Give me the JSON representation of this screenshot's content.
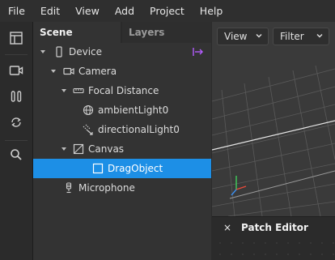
{
  "menu": [
    "File",
    "Edit",
    "View",
    "Add",
    "Project",
    "Help"
  ],
  "toolbar": {
    "icons": [
      "layout-icon",
      "camera-icon",
      "pause-icon",
      "refresh-icon",
      "search-icon"
    ]
  },
  "scene_panel": {
    "tabs": [
      "Scene",
      "Layers"
    ],
    "tree": [
      {
        "label": "Device",
        "icon": "phone-icon",
        "expanded": true
      },
      {
        "label": "Camera",
        "icon": "camera-icon",
        "expanded": true
      },
      {
        "label": "Focal Distance",
        "icon": "focal-distance-icon",
        "expanded": true
      },
      {
        "label": "ambientLight0",
        "icon": "globe-icon"
      },
      {
        "label": "directionalLight0",
        "icon": "directional-light-icon"
      },
      {
        "label": "Canvas",
        "icon": "canvas-icon",
        "expanded": true
      },
      {
        "label": "DragObject",
        "icon": "rectangle-icon",
        "selected": true
      },
      {
        "label": "Microphone",
        "icon": "microphone-icon"
      }
    ]
  },
  "viewport": {
    "view_dropdown": "View",
    "filter_dropdown": "Filter"
  },
  "patch_editor": {
    "close_label": "×",
    "title": "Patch Editor"
  },
  "colors": {
    "selection": "#1d8fe6",
    "link_accent": "#b45cff"
  }
}
